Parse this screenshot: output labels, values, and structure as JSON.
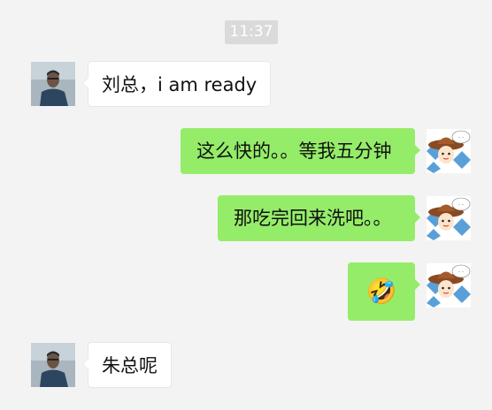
{
  "chat": {
    "timestamp": "11:37",
    "messages": [
      {
        "side": "incoming",
        "text": "刘总，i am ready",
        "avatar": "person-photo-avatar"
      },
      {
        "side": "outgoing",
        "text": "这么快的。。等我五分钟",
        "avatar": "cowboy-cartoon-avatar"
      },
      {
        "side": "outgoing",
        "text": "那吃完回来洗吧。。",
        "avatar": "cowboy-cartoon-avatar"
      },
      {
        "side": "outgoing",
        "text": "🤣",
        "avatar": "cowboy-cartoon-avatar"
      },
      {
        "side": "incoming",
        "text": "朱总呢",
        "avatar": "person-photo-avatar"
      }
    ]
  },
  "colors": {
    "background": "#f3f3f3",
    "outgoing_bubble": "#95ec69",
    "incoming_bubble": "#ffffff",
    "timestamp_bg": "#dadada"
  }
}
